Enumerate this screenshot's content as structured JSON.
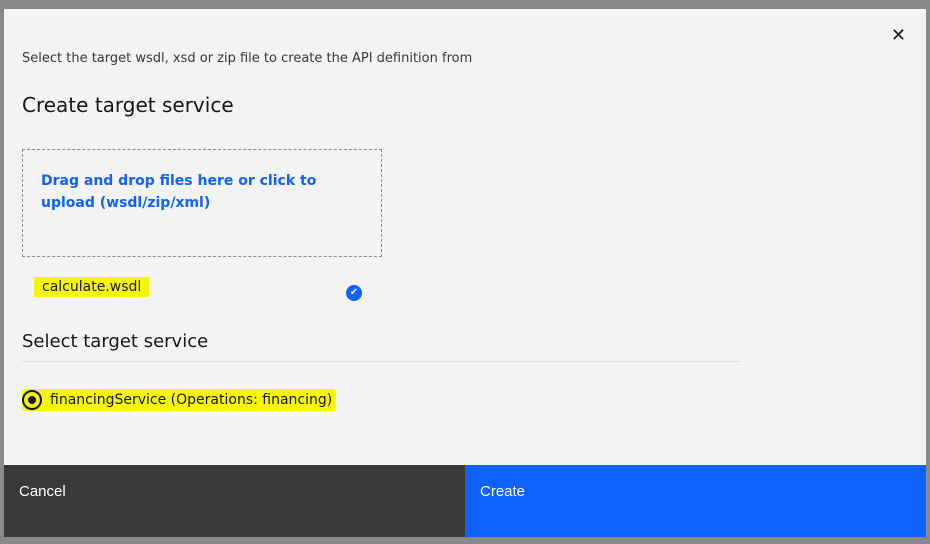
{
  "modal": {
    "close_icon": "close-icon",
    "label": "Select the target wsdl, xsd or zip file to create the API definition from",
    "title": "Create target service",
    "dropzone": "Drag and drop files here or click to upload (wsdl/zip/xml)",
    "file": {
      "name": "calculate.wsdl",
      "status_icon": "checkmark-filled-icon"
    },
    "section_title": "Select target service",
    "services": [
      {
        "label": "financingService (Operations: financing)",
        "selected": true
      }
    ],
    "cancel_label": "Cancel",
    "create_label": "Create"
  }
}
